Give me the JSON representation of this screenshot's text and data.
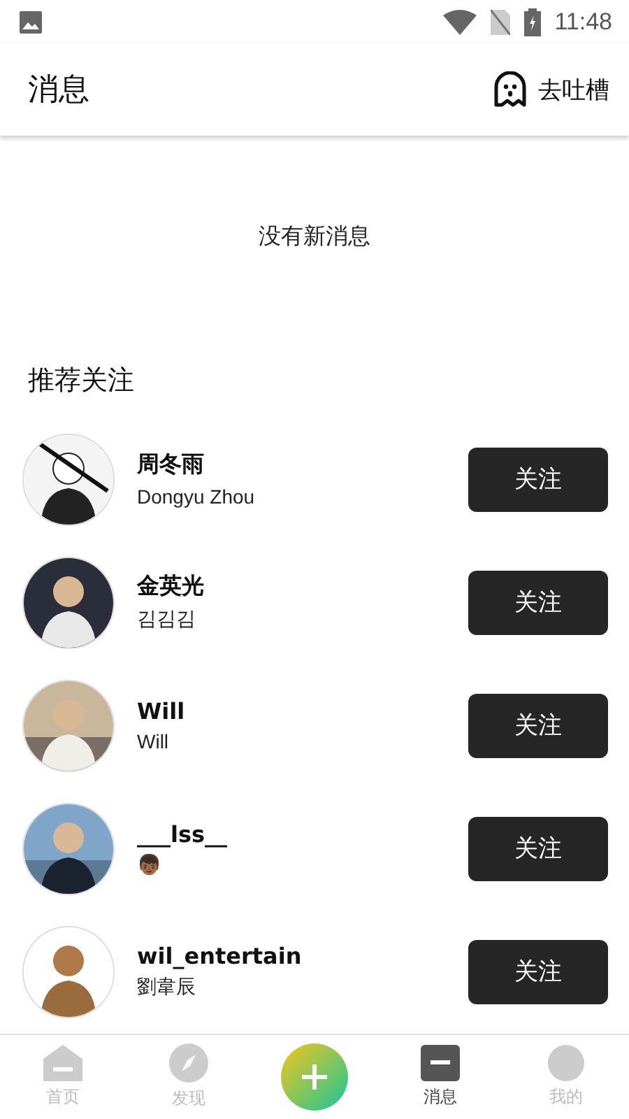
{
  "status_bar": {
    "time": "11:48"
  },
  "header": {
    "title": "消息",
    "action": "去吐槽"
  },
  "empty_state": "没有新消息",
  "recommend": {
    "title": "推荐关注",
    "users": [
      {
        "name": "周冬雨",
        "subtitle": "Dongyu Zhou",
        "button": "关注",
        "kind": "picture"
      },
      {
        "name": "金英光",
        "subtitle": "김김김",
        "button": "关注",
        "kind": "picture"
      },
      {
        "name": "Will",
        "subtitle": "Will",
        "button": "关注",
        "kind": "picture"
      },
      {
        "name": "___lss__",
        "subtitle": "👦🏾",
        "button": "关注",
        "kind": "picture"
      },
      {
        "name": "wil_entertain",
        "subtitle": "劉韋辰",
        "button": "关注",
        "kind": "picture"
      }
    ]
  },
  "bottom_nav": [
    {
      "kind": "home",
      "label": "首页",
      "selected": false
    },
    {
      "kind": "discover",
      "label": "发现",
      "selected": false
    },
    {
      "kind": "add"
    },
    {
      "kind": "messages",
      "label": "消息",
      "selected": true
    },
    {
      "kind": "profile",
      "label": "我的",
      "selected": false
    }
  ]
}
